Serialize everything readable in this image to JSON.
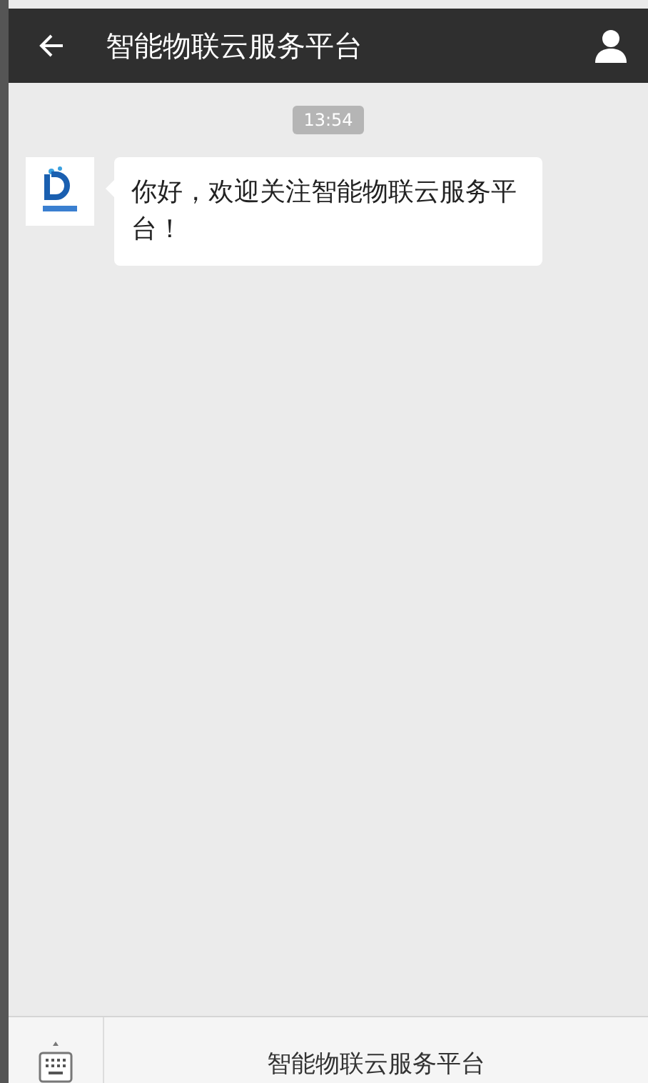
{
  "header": {
    "title": "智能物联云服务平台"
  },
  "messages": [
    {
      "kind": "time",
      "text": "13:54"
    },
    {
      "kind": "incoming",
      "text": "你好，欢迎关注智能物联云服务平台！"
    }
  ],
  "menu": {
    "items": [
      {
        "label": "智能物联云服务平台"
      }
    ]
  }
}
